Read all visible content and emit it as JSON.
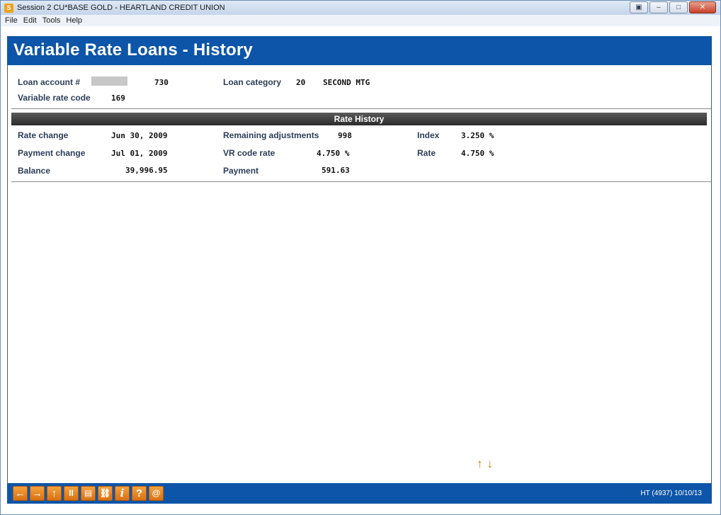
{
  "window": {
    "title": "Session 2 CU*BASE GOLD - HEARTLAND CREDIT UNION",
    "controls": {
      "restore": "▣",
      "minimize": "–",
      "maximize": "□",
      "close": "✕"
    }
  },
  "menu": {
    "items": [
      "File",
      "Edit",
      "Tools",
      "Help"
    ]
  },
  "header": {
    "title": "Variable Rate Loans - History"
  },
  "loan": {
    "account_label": "Loan account #",
    "account_value": "730",
    "category_label": "Loan category",
    "category_code": "20",
    "category_name": "SECOND MTG",
    "vr_code_label": "Variable rate code",
    "vr_code_value": "169"
  },
  "rate_history": {
    "section_title": "Rate History",
    "rate_change_label": "Rate change",
    "rate_change_value": "Jun 30, 2009",
    "payment_change_label": "Payment change",
    "payment_change_value": "Jul 01, 2009",
    "balance_label": "Balance",
    "balance_value": "39,996.95",
    "remaining_adj_label": "Remaining adjustments",
    "remaining_adj_value": "998",
    "vr_code_rate_label": "VR code rate",
    "vr_code_rate_value": "4.750 %",
    "payment_label": "Payment",
    "payment_value": "591.63",
    "index_label": "Index",
    "index_value": "3.250 %",
    "rate_label": "Rate",
    "rate_value": "4.750 %"
  },
  "paging": {
    "up": "↑",
    "down": "↓"
  },
  "toolbar": {
    "buttons": [
      "←",
      "→",
      "↑",
      "II",
      "▤",
      "⛓",
      "i",
      "?",
      "@"
    ],
    "status": "HT (4937) 10/10/13"
  },
  "colors": {
    "banner": "#0d55a8",
    "accent": "#d87010",
    "section_bar": "#2b2b2b"
  }
}
